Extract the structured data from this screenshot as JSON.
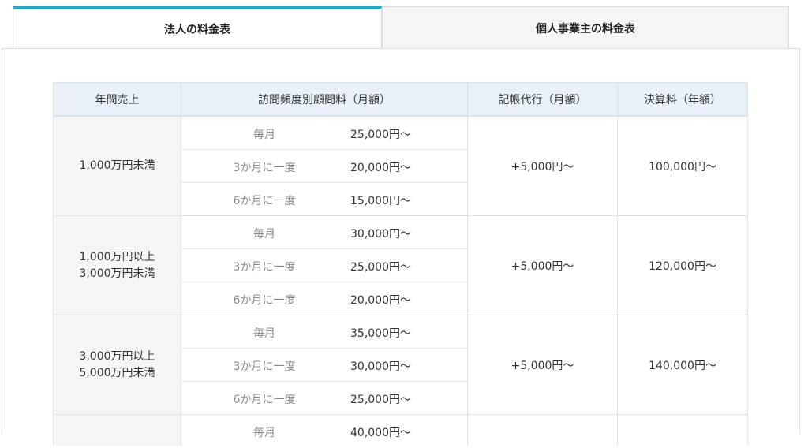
{
  "tabs": [
    {
      "label": "法人の料金表",
      "active": true
    },
    {
      "label": "個人事業主の料金表",
      "active": false
    }
  ],
  "accent_color": "#15aed0",
  "table": {
    "headers": [
      "年間売上",
      "訪問頻度別顧問料（月額）",
      "記帳代行（月額）",
      "決算料（年額）"
    ],
    "groups": [
      {
        "sales": "1,000万円未満",
        "visits": [
          {
            "freq": "毎月",
            "price": "25,000円～"
          },
          {
            "freq": "3か月に一度",
            "price": "20,000円～"
          },
          {
            "freq": "6か月に一度",
            "price": "15,000円～"
          }
        ],
        "bookkeeping": "+5,000円～",
        "settlement": "100,000円～"
      },
      {
        "sales": "1,000万円以上\n3,000万円未満",
        "visits": [
          {
            "freq": "毎月",
            "price": "30,000円～"
          },
          {
            "freq": "3か月に一度",
            "price": "25,000円～"
          },
          {
            "freq": "6か月に一度",
            "price": "20,000円～"
          }
        ],
        "bookkeeping": "+5,000円～",
        "settlement": "120,000円～"
      },
      {
        "sales": "3,000万円以上\n5,000万円未満",
        "visits": [
          {
            "freq": "毎月",
            "price": "35,000円～"
          },
          {
            "freq": "3か月に一度",
            "price": "30,000円～"
          },
          {
            "freq": "6か月に一度",
            "price": "25,000円～"
          }
        ],
        "bookkeeping": "+5,000円～",
        "settlement": "140,000円～"
      },
      {
        "sales": "",
        "visits": [
          {
            "freq": "毎月",
            "price": "40,000円～"
          }
        ],
        "bookkeeping": "",
        "settlement": ""
      }
    ]
  }
}
